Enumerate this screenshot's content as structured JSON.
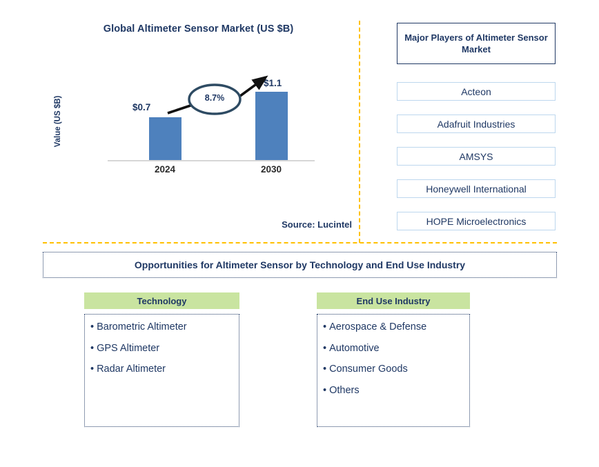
{
  "chart_data": {
    "type": "bar",
    "title": "Global Altimeter Sensor Market (US $B)",
    "xlabel": "",
    "ylabel": "Value (US $B)",
    "categories": [
      "2024",
      "2030"
    ],
    "values": [
      0.7,
      1.1
    ],
    "data_labels": [
      "$0.7",
      "$1.1"
    ],
    "ylim": [
      0,
      1.25
    ],
    "grid": false,
    "legend": "none",
    "bar_color": "#4E81BD",
    "annotations": [
      {
        "name": "cagr-callout",
        "text": "8.7%",
        "shape": "ellipse",
        "from_category": "2024",
        "to_category": "2030",
        "meaning": "CAGR from 2024 to 2030"
      }
    ],
    "source": "Source: Lucintel"
  },
  "chart": {
    "title": "Global Altimeter Sensor Market (US $B)",
    "y_axis_label": "Value (US $B)",
    "bars": [
      {
        "category": "2024",
        "label": "$0.7",
        "value": 0.7
      },
      {
        "category": "2030",
        "label": "$1.1",
        "value": 1.1
      }
    ],
    "cagr_label": "8.7%",
    "source": "Source: Lucintel"
  },
  "players": {
    "header": "Major Players of Altimeter Sensor Market",
    "items": [
      "Acteon",
      "Adafruit Industries",
      "AMSYS",
      "Honeywell International",
      "HOPE Microelectronics"
    ]
  },
  "opportunities": {
    "banner": "Opportunities for Altimeter Sensor by Technology and End Use Industry",
    "columns": [
      {
        "header": "Technology",
        "items": [
          "Barometric Altimeter",
          "GPS Altimeter",
          "Radar Altimeter"
        ]
      },
      {
        "header": "End Use Industry",
        "items": [
          "Aerospace & Defense",
          "Automotive",
          "Consumer Goods",
          "Others"
        ]
      }
    ]
  },
  "colors": {
    "bar_blue": "#4E81BD",
    "navy_text": "#1F3864",
    "divider_gold": "#FFC000",
    "header_green": "#C9E4A0",
    "player_border": "#BDD7EE",
    "callout_outline": "#2E4B63"
  },
  "bullet": "•"
}
